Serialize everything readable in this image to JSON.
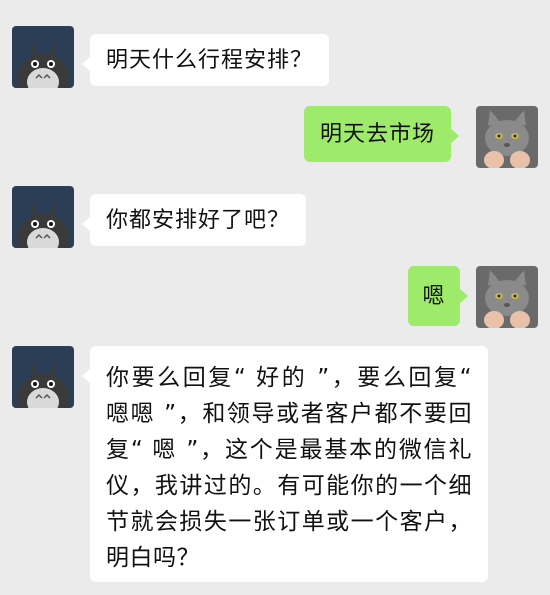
{
  "messages": [
    {
      "side": "left",
      "text": "明天什么行程安排？"
    },
    {
      "side": "right",
      "text": "明天去市场"
    },
    {
      "side": "left",
      "text": "你都安排好了吧？"
    },
    {
      "side": "right",
      "text": "嗯"
    },
    {
      "side": "left",
      "text": "你要么回复“ 好的 ”，要么回复“ 嗯嗯 ”，和领导或者客户都不要回复“ 嗯 ”，这个是最基本的微信礼仪，我讲过的。有可能你的一个细节就会损失一张订单或一个客户，明白吗？"
    }
  ],
  "avatars": {
    "left": "totoro-avatar",
    "right": "gray-cat-avatar"
  },
  "colors": {
    "background": "#ebebeb",
    "incoming_bubble": "#ffffff",
    "outgoing_bubble": "#9eea6a"
  }
}
